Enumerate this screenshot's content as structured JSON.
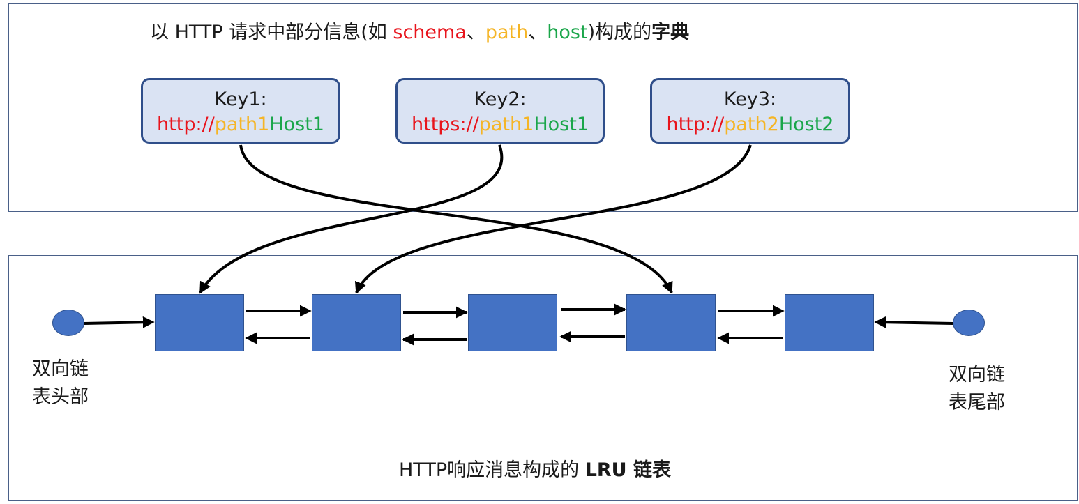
{
  "dictionary": {
    "title_prefix": "以 HTTP 请求中部分信息(如 ",
    "title_schema": "schema",
    "title_sep1": "、",
    "title_path": "path",
    "title_sep2": "、",
    "title_host": "host",
    "title_suffix": ")构成的",
    "title_bold": "字典",
    "keys": [
      {
        "label": "Key1:",
        "scheme": "http://",
        "path": "path1",
        "host": "Host1"
      },
      {
        "label": "Key2:",
        "scheme": "https://",
        "path": "path1",
        "host": "Host1"
      },
      {
        "label": "Key3:",
        "scheme": "http://",
        "path": "path2",
        "host": "Host2"
      }
    ]
  },
  "lru": {
    "title_prefix": "HTTP响应消息构成的 ",
    "title_bold": "LRU 链表",
    "head_label_line1": "双向链",
    "head_label_line2": "表头部",
    "tail_label_line1": "双向链",
    "tail_label_line2": "表尾部"
  },
  "colors": {
    "schema": "#e8141c",
    "path": "#f5b526",
    "host": "#1aa64a",
    "node_fill": "#4472c4",
    "key_fill": "#dae3f3",
    "key_border": "#2f4e8a"
  }
}
